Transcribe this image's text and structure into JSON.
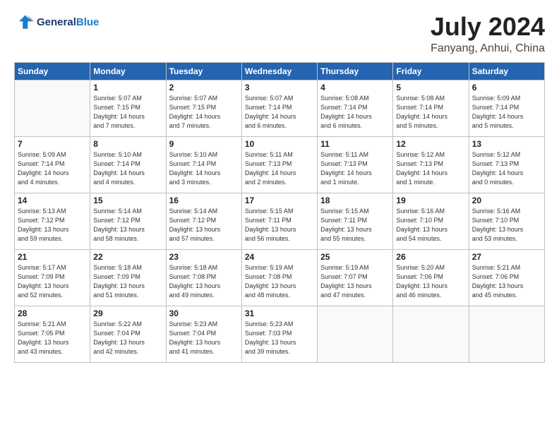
{
  "header": {
    "logo_line1": "General",
    "logo_line2": "Blue",
    "month": "July 2024",
    "location": "Fanyang, Anhui, China"
  },
  "weekdays": [
    "Sunday",
    "Monday",
    "Tuesday",
    "Wednesday",
    "Thursday",
    "Friday",
    "Saturday"
  ],
  "weeks": [
    [
      {
        "day": "",
        "info": ""
      },
      {
        "day": "1",
        "info": "Sunrise: 5:07 AM\nSunset: 7:15 PM\nDaylight: 14 hours\nand 7 minutes."
      },
      {
        "day": "2",
        "info": "Sunrise: 5:07 AM\nSunset: 7:15 PM\nDaylight: 14 hours\nand 7 minutes."
      },
      {
        "day": "3",
        "info": "Sunrise: 5:07 AM\nSunset: 7:14 PM\nDaylight: 14 hours\nand 6 minutes."
      },
      {
        "day": "4",
        "info": "Sunrise: 5:08 AM\nSunset: 7:14 PM\nDaylight: 14 hours\nand 6 minutes."
      },
      {
        "day": "5",
        "info": "Sunrise: 5:08 AM\nSunset: 7:14 PM\nDaylight: 14 hours\nand 5 minutes."
      },
      {
        "day": "6",
        "info": "Sunrise: 5:09 AM\nSunset: 7:14 PM\nDaylight: 14 hours\nand 5 minutes."
      }
    ],
    [
      {
        "day": "7",
        "info": "Sunrise: 5:09 AM\nSunset: 7:14 PM\nDaylight: 14 hours\nand 4 minutes."
      },
      {
        "day": "8",
        "info": "Sunrise: 5:10 AM\nSunset: 7:14 PM\nDaylight: 14 hours\nand 4 minutes."
      },
      {
        "day": "9",
        "info": "Sunrise: 5:10 AM\nSunset: 7:14 PM\nDaylight: 14 hours\nand 3 minutes."
      },
      {
        "day": "10",
        "info": "Sunrise: 5:11 AM\nSunset: 7:13 PM\nDaylight: 14 hours\nand 2 minutes."
      },
      {
        "day": "11",
        "info": "Sunrise: 5:11 AM\nSunset: 7:13 PM\nDaylight: 14 hours\nand 1 minute."
      },
      {
        "day": "12",
        "info": "Sunrise: 5:12 AM\nSunset: 7:13 PM\nDaylight: 14 hours\nand 1 minute."
      },
      {
        "day": "13",
        "info": "Sunrise: 5:12 AM\nSunset: 7:13 PM\nDaylight: 14 hours\nand 0 minutes."
      }
    ],
    [
      {
        "day": "14",
        "info": "Sunrise: 5:13 AM\nSunset: 7:12 PM\nDaylight: 13 hours\nand 59 minutes."
      },
      {
        "day": "15",
        "info": "Sunrise: 5:14 AM\nSunset: 7:12 PM\nDaylight: 13 hours\nand 58 minutes."
      },
      {
        "day": "16",
        "info": "Sunrise: 5:14 AM\nSunset: 7:12 PM\nDaylight: 13 hours\nand 57 minutes."
      },
      {
        "day": "17",
        "info": "Sunrise: 5:15 AM\nSunset: 7:11 PM\nDaylight: 13 hours\nand 56 minutes."
      },
      {
        "day": "18",
        "info": "Sunrise: 5:15 AM\nSunset: 7:11 PM\nDaylight: 13 hours\nand 55 minutes."
      },
      {
        "day": "19",
        "info": "Sunrise: 5:16 AM\nSunset: 7:10 PM\nDaylight: 13 hours\nand 54 minutes."
      },
      {
        "day": "20",
        "info": "Sunrise: 5:16 AM\nSunset: 7:10 PM\nDaylight: 13 hours\nand 53 minutes."
      }
    ],
    [
      {
        "day": "21",
        "info": "Sunrise: 5:17 AM\nSunset: 7:09 PM\nDaylight: 13 hours\nand 52 minutes."
      },
      {
        "day": "22",
        "info": "Sunrise: 5:18 AM\nSunset: 7:09 PM\nDaylight: 13 hours\nand 51 minutes."
      },
      {
        "day": "23",
        "info": "Sunrise: 5:18 AM\nSunset: 7:08 PM\nDaylight: 13 hours\nand 49 minutes."
      },
      {
        "day": "24",
        "info": "Sunrise: 5:19 AM\nSunset: 7:08 PM\nDaylight: 13 hours\nand 48 minutes."
      },
      {
        "day": "25",
        "info": "Sunrise: 5:19 AM\nSunset: 7:07 PM\nDaylight: 13 hours\nand 47 minutes."
      },
      {
        "day": "26",
        "info": "Sunrise: 5:20 AM\nSunset: 7:06 PM\nDaylight: 13 hours\nand 46 minutes."
      },
      {
        "day": "27",
        "info": "Sunrise: 5:21 AM\nSunset: 7:06 PM\nDaylight: 13 hours\nand 45 minutes."
      }
    ],
    [
      {
        "day": "28",
        "info": "Sunrise: 5:21 AM\nSunset: 7:05 PM\nDaylight: 13 hours\nand 43 minutes."
      },
      {
        "day": "29",
        "info": "Sunrise: 5:22 AM\nSunset: 7:04 PM\nDaylight: 13 hours\nand 42 minutes."
      },
      {
        "day": "30",
        "info": "Sunrise: 5:23 AM\nSunset: 7:04 PM\nDaylight: 13 hours\nand 41 minutes."
      },
      {
        "day": "31",
        "info": "Sunrise: 5:23 AM\nSunset: 7:03 PM\nDaylight: 13 hours\nand 39 minutes."
      },
      {
        "day": "",
        "info": ""
      },
      {
        "day": "",
        "info": ""
      },
      {
        "day": "",
        "info": ""
      }
    ]
  ]
}
